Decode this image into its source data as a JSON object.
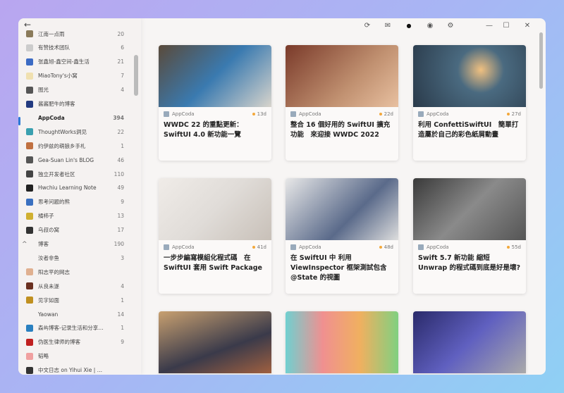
{
  "toolbar": {
    "icons": [
      "refresh-icon",
      "mail-open-icon",
      "bell-icon",
      "eye-icon",
      "gear-icon",
      "minimize-icon",
      "maximize-icon",
      "close-icon"
    ],
    "glyphs": [
      "⟳",
      "✉",
      "●",
      "◉",
      "⚙",
      "—",
      "☐",
      "✕"
    ]
  },
  "sidebar": {
    "back": "←",
    "items": [
      {
        "label": "江南一点雨",
        "count": "20",
        "color": "#8a7a5a"
      },
      {
        "label": "有赞技术团队",
        "count": "6",
        "color": "#ccc"
      },
      {
        "label": "张鑫旭-鑫空间-鑫生活",
        "count": "21",
        "color": "#3c6bc4"
      },
      {
        "label": "MiaoTony's小窝",
        "count": "7",
        "color": "#f0e0b0"
      },
      {
        "label": "图光",
        "count": "4",
        "color": "#555"
      },
      {
        "label": "酱酱肥牛的博客",
        "count": "",
        "color": "#223a80"
      },
      {
        "label": "AppCoda",
        "count": "394",
        "color": "transparent"
      },
      {
        "label": "ThoughtWorks洞见",
        "count": "22",
        "color": "#3aa0b0"
      },
      {
        "label": "约伊兹的萌狼乡手札",
        "count": "1",
        "color": "#c07040"
      },
      {
        "label": "Gea-Suan Lin's BLOG",
        "count": "46",
        "color": "#555"
      },
      {
        "label": "独立开发者社区",
        "count": "110",
        "color": "#444"
      },
      {
        "label": "Hwchiu Learning Note",
        "count": "49",
        "color": "#222"
      },
      {
        "label": "思考问题的熊",
        "count": "9",
        "color": "#3a70c0"
      },
      {
        "label": "橘柿子",
        "count": "13",
        "color": "#d0b030"
      },
      {
        "label": "乌叔の窝",
        "count": "17",
        "color": "#333"
      },
      {
        "label": "博客",
        "count": "190",
        "color": "transparent",
        "group": true
      },
      {
        "label": "汝者非鱼",
        "count": "3",
        "color": "transparent"
      },
      {
        "label": "阳志平的网志",
        "count": "",
        "color": "#e0b090"
      },
      {
        "label": "从良未遂",
        "count": "4",
        "color": "#6a3020"
      },
      {
        "label": "见字如面",
        "count": "1",
        "color": "#c09020"
      },
      {
        "label": "Yaowan",
        "count": "14",
        "color": "transparent"
      },
      {
        "label": "森屿博客-记录生活和分享知识的...",
        "count": "1",
        "color": "#2a80c0"
      },
      {
        "label": "伪医生律师的博客",
        "count": "9",
        "color": "#c02020"
      },
      {
        "label": "韬略",
        "count": "",
        "color": "#f0a0a0"
      },
      {
        "label": "中文日志 on Yihui Xie | 谢益辉",
        "count": "",
        "color": "#333"
      }
    ]
  },
  "cards": [
    {
      "source": "AppCoda",
      "age": "13d",
      "title": "WWDC 22 的重點更新：SwiftUI 4.0 新功能一覽",
      "image": "linear-gradient(135deg,#5a4a3a,#3a7ab0 50%,#d8d4cc)"
    },
    {
      "source": "AppCoda",
      "age": "22d",
      "title": "整合 16 個好用的 SwiftUI 擴充功能　來迎接 WWDC 2022",
      "image": "linear-gradient(135deg,#7a3a2a,#c09070 60%,#e8c0a0)"
    },
    {
      "source": "AppCoda",
      "age": "27d",
      "title": "利用 ConfettiSwiftUI　簡單打造屬於自己的彩色紙屑動畫",
      "image": "radial-gradient(circle at 60% 40%,#f0c080,#4a6a80 30%,#2a3a4a)"
    },
    {
      "source": "AppCoda",
      "age": "41d",
      "title": "一步步編寫模組化程式碼　在 SwiftUI 套用 Swift Package",
      "image": "linear-gradient(135deg,#f0ece8,#e0dcd8 50%,#c8c0b8)"
    },
    {
      "source": "AppCoda",
      "age": "48d",
      "title": "在 SwiftUI 中 利用 ViewInspector 框架測試包含 @State 的視圖",
      "image": "linear-gradient(135deg,#e8e8e8,#5a6a8a 60%,#ddd)"
    },
    {
      "source": "AppCoda",
      "age": "55d",
      "title": "Swift 5.7 新功能 縮短 Unwrap 的程式碼到底是好是壞?",
      "image": "linear-gradient(135deg,#3a3a3a,#8a8a8a 50%,#555)"
    },
    {
      "source": "",
      "age": "",
      "title": "",
      "image": "linear-gradient(160deg,#c8a070,#3a3a4a 60%,#a06040)"
    },
    {
      "source": "",
      "age": "",
      "title": "",
      "image": "linear-gradient(90deg,#70d0d0,#f09090 33%,#f0b060 66%,#80d080)"
    },
    {
      "source": "",
      "age": "",
      "title": "",
      "image": "linear-gradient(135deg,#2a2a6a,#6060c0 50%,#aaa)"
    }
  ]
}
